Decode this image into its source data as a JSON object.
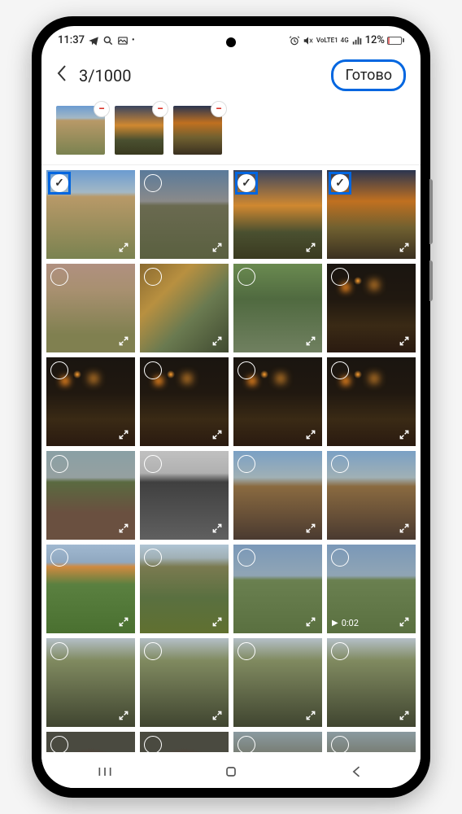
{
  "status": {
    "time": "11:37",
    "network_label": "VoLTE1",
    "signal_label": "4G",
    "battery_percent": "12%"
  },
  "header": {
    "selection_counter": "3/1000",
    "done_label": "Готово"
  },
  "selected_thumbs": [
    {
      "style": "sky-city"
    },
    {
      "style": "sunset1"
    },
    {
      "style": "sunset2"
    }
  ],
  "grid": [
    {
      "style": "sky-city",
      "selected": true,
      "highlight": true,
      "expand": true
    },
    {
      "style": "sky-city2",
      "selected": false,
      "highlight": false,
      "expand": true
    },
    {
      "style": "sunset1",
      "selected": true,
      "highlight": true,
      "expand": true
    },
    {
      "style": "sunset2",
      "selected": true,
      "highlight": true,
      "expand": true
    },
    {
      "style": "playground",
      "selected": false,
      "expand": true
    },
    {
      "style": "autumn-path",
      "selected": false,
      "expand": true
    },
    {
      "style": "bike-path",
      "selected": false,
      "expand": true
    },
    {
      "style": "night-lamp",
      "selected": false,
      "expand": true
    },
    {
      "style": "night-lamp",
      "selected": false,
      "expand": true
    },
    {
      "style": "night-lamp",
      "selected": false,
      "expand": true
    },
    {
      "style": "night-lamp",
      "selected": false,
      "expand": true
    },
    {
      "style": "night-lamp",
      "selected": false,
      "expand": true
    },
    {
      "style": "dirt-road",
      "selected": false,
      "expand": true
    },
    {
      "style": "bw-factory",
      "selected": false,
      "expand": true
    },
    {
      "style": "autumn-house",
      "selected": false,
      "expand": true
    },
    {
      "style": "autumn-house",
      "selected": false,
      "expand": true
    },
    {
      "style": "green-grass",
      "selected": false,
      "expand": true
    },
    {
      "style": "green-trees",
      "selected": false,
      "expand": true
    },
    {
      "style": "sky-field",
      "selected": false,
      "expand": true
    },
    {
      "style": "sky-field",
      "selected": false,
      "expand": true,
      "video_duration": "0:02"
    },
    {
      "style": "fence-trees",
      "selected": false,
      "expand": true
    },
    {
      "style": "fence-trees",
      "selected": false,
      "expand": true
    },
    {
      "style": "fence-trees",
      "selected": false,
      "expand": true
    },
    {
      "style": "fence-trees",
      "selected": false,
      "expand": true
    },
    {
      "style": "blur-red",
      "selected": false,
      "expand": false
    },
    {
      "style": "blur-red",
      "selected": false,
      "expand": false
    },
    {
      "style": "people",
      "selected": false,
      "expand": false
    },
    {
      "style": "people",
      "selected": false,
      "expand": false
    }
  ],
  "colors": {
    "accent_highlight": "#0066e0"
  }
}
